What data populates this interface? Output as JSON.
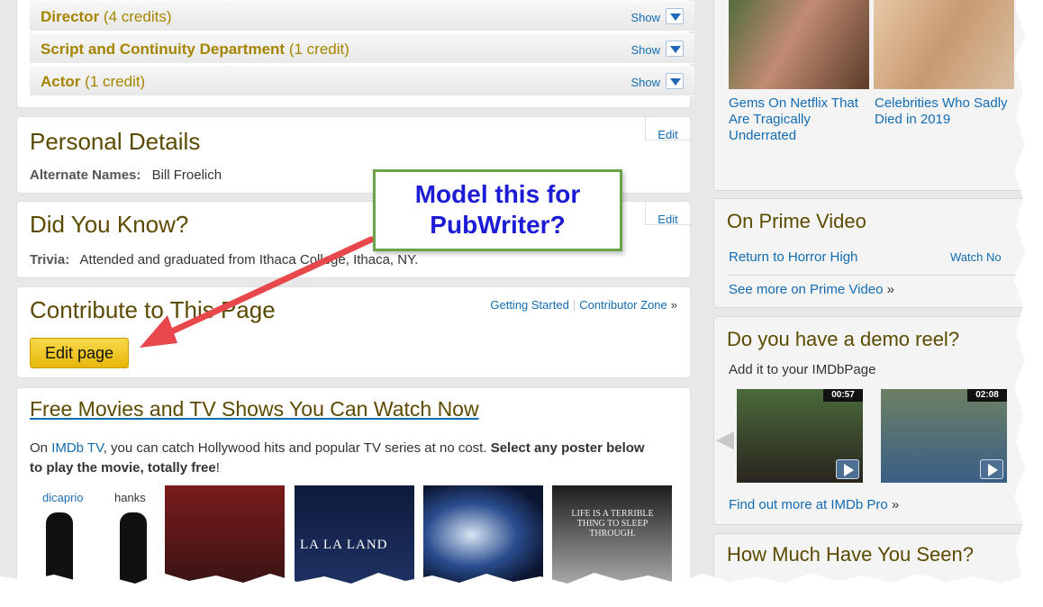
{
  "filmography": {
    "rows": [
      {
        "title": "Director",
        "credits": "(4 credits)",
        "show": "Show"
      },
      {
        "title": "Script and Continuity Department",
        "credits": "(1 credit)",
        "show": "Show"
      },
      {
        "title": "Actor",
        "credits": "(1 credit)",
        "show": "Show"
      }
    ]
  },
  "personal_details": {
    "heading": "Personal Details",
    "edit": "Edit",
    "label": "Alternate Names:",
    "value": "Bill Froelich"
  },
  "did_you_know": {
    "heading": "Did You Know?",
    "edit": "Edit",
    "label": "Trivia:",
    "value": "Attended and graduated from Ithaca College, Ithaca, NY."
  },
  "contribute": {
    "heading": "Contribute to This Page",
    "getting_started": "Getting Started",
    "separator": "|",
    "contributor_zone": "Contributor Zone",
    "raquo": "»",
    "edit_button": "Edit page"
  },
  "free_movies": {
    "heading": "Free Movies and TV Shows You Can Watch Now",
    "para_1": "On ",
    "imdb_tv": "IMDb TV",
    "para_2": ", you can catch Hollywood hits and popular TV series at no cost. ",
    "para_bold": "Select any poster below to play the movie, totally free",
    "para_end": "!",
    "poster_1_name_1": "dicaprio",
    "poster_1_name_2": "hanks",
    "poster_3_title": "LA LA LAND",
    "poster_5_text": "LIFE IS A TERRIBLE THING TO SLEEP THROUGH."
  },
  "sidebar": {
    "gems_caption": "Gems On Netflix That Are Tragically Underrated",
    "celeb_caption": "Celebrities Who Sadly Died in 2019",
    "prime_heading": "On Prime Video",
    "prime_item": "Return to Horror High",
    "prime_watch": "Watch No",
    "prime_more": "See more on Prime Video",
    "raquo": "»",
    "demo_heading": "Do you have a demo reel?",
    "demo_sub": "Add it to your IMDbPage",
    "video_1_duration": "00:57",
    "video_2_duration": "02:08",
    "demo_more": "Find out more at IMDb Pro",
    "howmuch_heading": "How Much Have You Seen?"
  },
  "annotation": {
    "line_1": "Model this for",
    "line_2": "PubWriter?",
    "border_color": "#6ba34a",
    "text_color": "#1c1cd6",
    "arrow_color": "#e8484b"
  },
  "colors": {
    "link": "#136cb2",
    "heading": "#5c4a00",
    "filmo_title": "#a58500",
    "edit_button": "#f3c623"
  }
}
